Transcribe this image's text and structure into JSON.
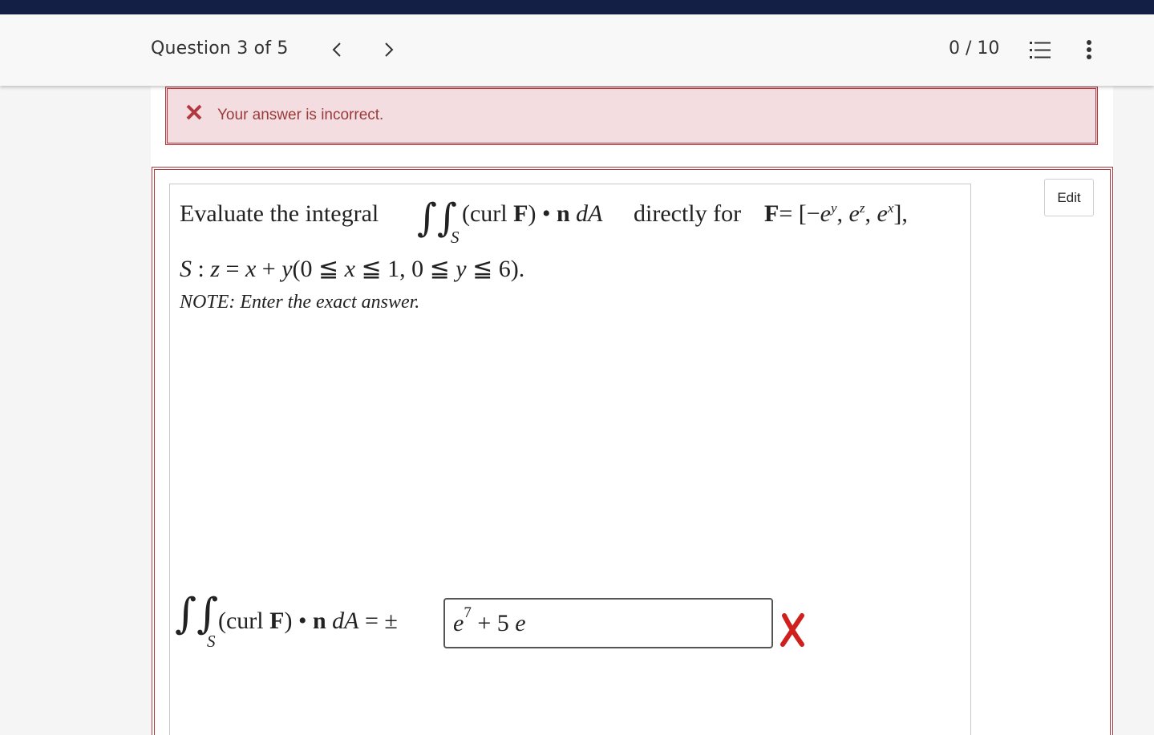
{
  "header": {
    "question_label": "Question 3 of 5",
    "score": "0 / 10",
    "icons": [
      "chevron-left-icon",
      "chevron-right-icon",
      "numbered-list-icon",
      "more-vertical-icon"
    ]
  },
  "alert": {
    "message": "Your answer is incorrect.",
    "icon": "close-icon",
    "color": "#9a3a3a"
  },
  "question": {
    "edit_label": "Edit",
    "intro": "Evaluate the integral",
    "integrand": "(curl F) • n dA",
    "middle": "directly for",
    "field": "F= [−e^y, e^z, e^x],",
    "surface": "S : z = x + y(0 ≦ x ≦ 1, 0 ≦ y ≦ 6).",
    "note": "NOTE: Enter the exact answer."
  },
  "answer": {
    "lhs": "(curl F) • n dA = ±",
    "value": "e^7 + 5 e",
    "status": "incorrect",
    "status_color": "#d0201d"
  },
  "colors": {
    "top_strip": "#141f45",
    "error_border": "#b0393f",
    "error_bg": "#f3dde0"
  }
}
